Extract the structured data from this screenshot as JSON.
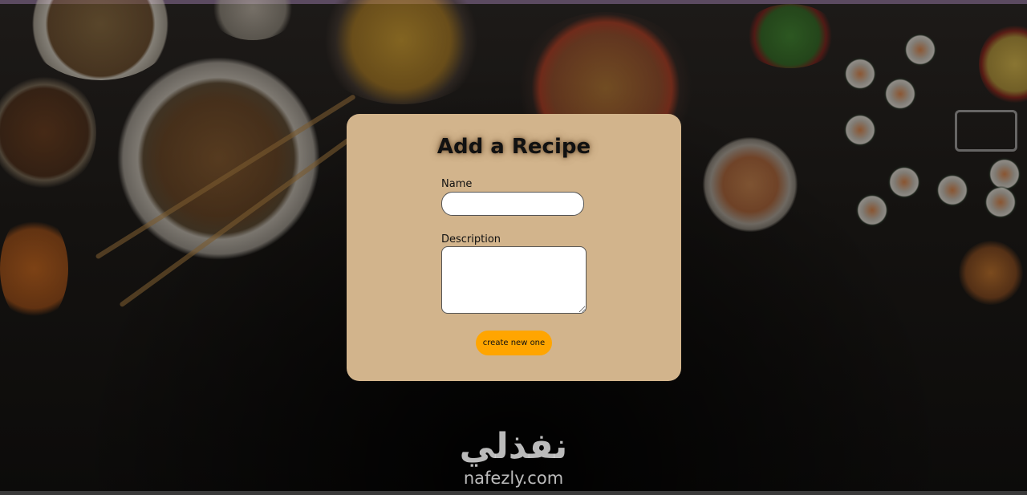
{
  "form": {
    "title": "Add a Recipe",
    "name_label": "Name",
    "name_value": "",
    "description_label": "Description",
    "description_value": "",
    "submit_label": "create new one"
  },
  "brand": {
    "arabic": "نفذلي",
    "latin": "nafezly.com"
  },
  "colors": {
    "card_background": "#d2b48c",
    "button": "#ffa500",
    "page_background": "#141210"
  }
}
